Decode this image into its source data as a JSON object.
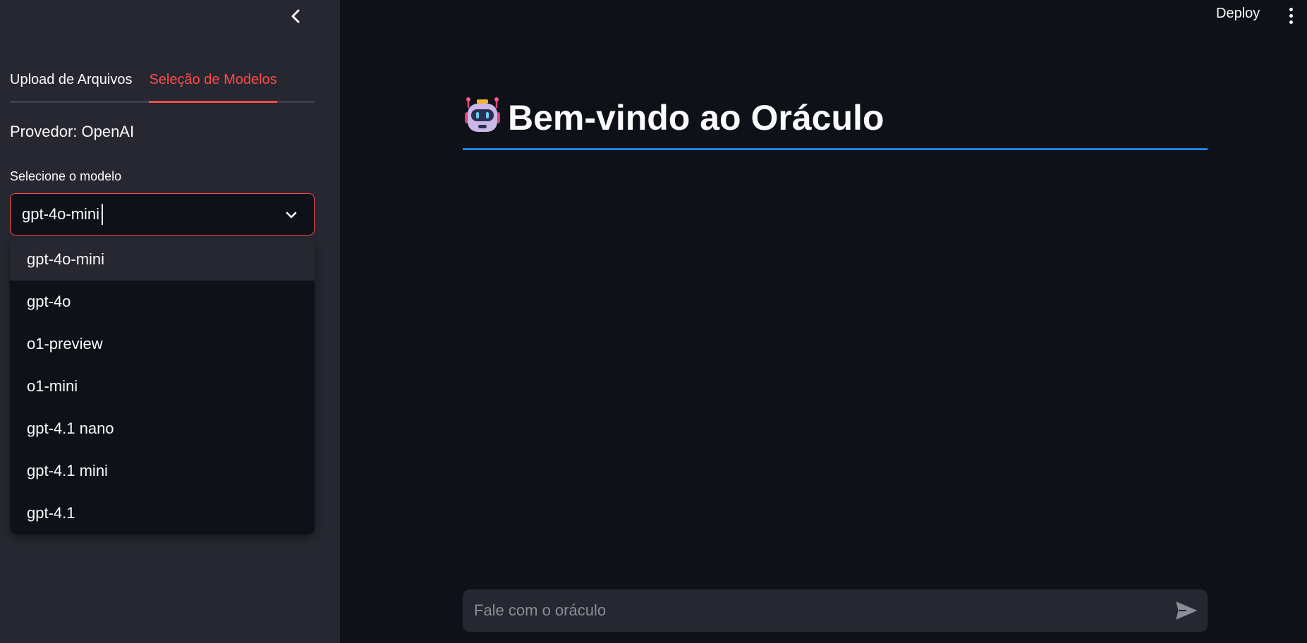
{
  "header": {
    "deploy_label": "Deploy",
    "menu_icon": "more-vertical-icon"
  },
  "sidebar": {
    "collapse_icon": "chevron-left-icon",
    "tabs": [
      {
        "label": "Upload de Arquivos",
        "active": false
      },
      {
        "label": "Seleção de Modelos",
        "active": true
      }
    ],
    "provider_text": "Provedor: OpenAI",
    "model_select": {
      "label": "Selecione o modelo",
      "value": "gpt-4o-mini",
      "options": [
        "gpt-4o-mini",
        "gpt-4o",
        "o1-preview",
        "o1-mini",
        "gpt-4.1 nano",
        "gpt-4.1 mini",
        "gpt-4.1"
      ],
      "highlighted_index": 0
    }
  },
  "main": {
    "title_icon": "robot-icon",
    "title": "Bem-vindo ao Oráculo"
  },
  "chat": {
    "placeholder": "Fale com o oráculo",
    "send_icon": "send-icon"
  },
  "colors": {
    "background": "#0e1117",
    "sidebar": "#262730",
    "accent": "#ff4b4b",
    "title_divider": "#1c83e1"
  }
}
